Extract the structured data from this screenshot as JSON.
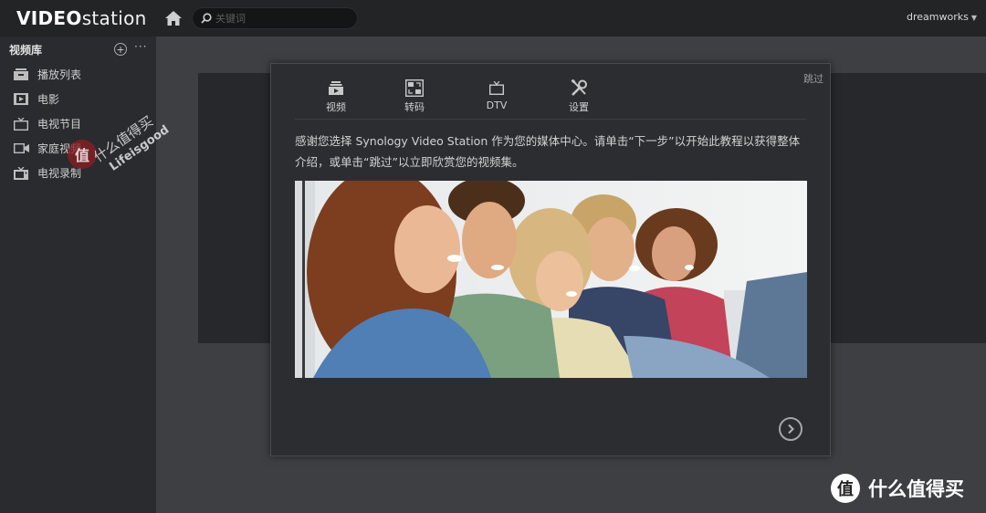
{
  "app": {
    "logo_bold": "VIDEO",
    "logo_light": "station"
  },
  "topbar": {
    "search_placeholder": "关键词",
    "user": "dreamworks"
  },
  "sidebar": {
    "title": "视频库",
    "add_label": "+",
    "more_label": "···",
    "items": [
      {
        "label": "播放列表",
        "icon": "playlist-icon"
      },
      {
        "label": "电影",
        "icon": "movie-icon"
      },
      {
        "label": "电视节目",
        "icon": "tv-icon"
      },
      {
        "label": "家庭视频",
        "icon": "camcorder-icon"
      },
      {
        "label": "电视录制",
        "icon": "tv-recording-icon"
      }
    ],
    "watermark": {
      "line1": "什么值得买",
      "line2": "Lifeisgood"
    }
  },
  "dialog": {
    "skip": "跳过",
    "tabs": [
      {
        "label": "视频",
        "icon": "video-stack-icon"
      },
      {
        "label": "转码",
        "icon": "transcode-icon"
      },
      {
        "label": "DTV",
        "icon": "dtv-icon"
      },
      {
        "label": "设置",
        "icon": "settings-tools-icon"
      }
    ],
    "intro_text": "感谢您选择 Synology Video Station 作为您的媒体中心。请单击“下一步”以开始此教程以获得整体介绍，或单击“跳过”以立即欣赏您的视频集。",
    "hero_image": "group-of-friends-watching-screen-photo",
    "next_icon": "chevron-right-circle-icon"
  },
  "brand_watermark": {
    "logo_char": "值",
    "text": "什么值得买"
  },
  "colors": {
    "topbar": "#232426",
    "sidebar": "#2a2b2e",
    "background": "#3d3f42",
    "dialog": "#2c2d30"
  }
}
